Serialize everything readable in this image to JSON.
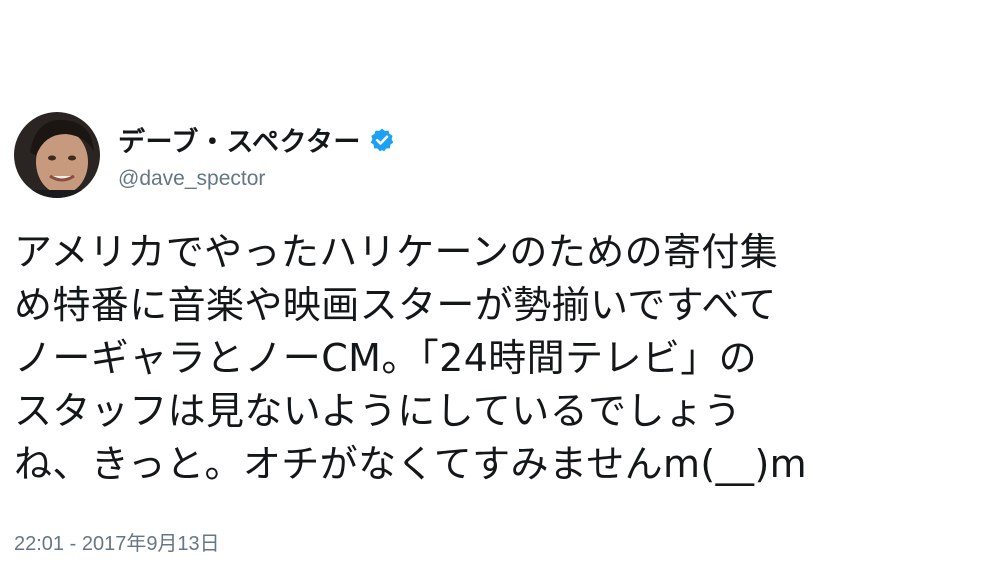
{
  "tweet": {
    "author": {
      "display_name": "デーブ・スペクター",
      "handle": "@dave_spector",
      "verified": true,
      "verified_icon": "verified-badge-icon",
      "avatar": "avatar-photo"
    },
    "text_lines": [
      "アメリカでやったハリケーンのための寄付集",
      "め特番に音楽や映画スターが勢揃いですべて",
      "ノーギャラとノーCM。「24時間テレビ」の",
      "スタッフは見ないようにしているでしょう",
      "ね、きっと。オチがなくてすみませんm(__)m"
    ],
    "timestamp": "22:01 - 2017年9月13日"
  },
  "colors": {
    "text": "#14171a",
    "secondary": "#657786",
    "verified": "#1da1f2",
    "background": "#ffffff"
  }
}
